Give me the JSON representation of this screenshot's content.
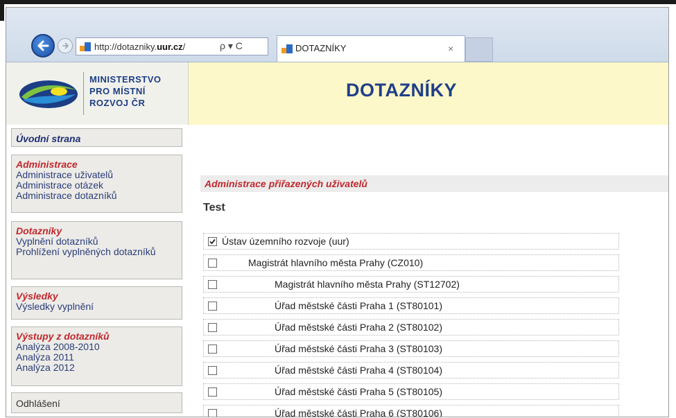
{
  "browser": {
    "address_url_prefix": "http://dotazniky.",
    "address_url_domain": "uur.cz",
    "address_url_suffix": "/",
    "address_tools": "ρ ▾ C",
    "tab_title": "DOTAZNÍKY",
    "tab_close": "×"
  },
  "header": {
    "logo_line1": "MINISTERSTVO",
    "logo_line2": "PRO MÍSTNÍ",
    "logo_line3": "ROZVOJ ČR",
    "title": "DOTAZNÍKY"
  },
  "sidebar": {
    "home": "Úvodní strana",
    "admin": {
      "head": "Administrace",
      "items": [
        "Administrace uživatelů",
        "Administrace otázek",
        "Administrace dotazníků"
      ]
    },
    "questionnaires": {
      "head": "Dotazníky",
      "items": [
        "Vyplnění dotazníků",
        "Prohlížení vyplněných dotazníků"
      ]
    },
    "results": {
      "head": "Výsledky",
      "items": [
        "Výsledky vyplnění"
      ]
    },
    "outputs": {
      "head": "Výstupy z dotazníků",
      "items": [
        "Analýza 2008-2010",
        "Analýza 2011",
        "Analýza 2012"
      ]
    },
    "logout": "Odhlášení"
  },
  "main": {
    "section_title": "Administrace přiřazených uživatelů",
    "sub_title": "Test",
    "rows": [
      {
        "label": "Ústav územního rozvoje (uur)",
        "checked": true,
        "level": 0
      },
      {
        "label": "Magistrát hlavního města Prahy (CZ010)",
        "checked": false,
        "level": 1
      },
      {
        "label": "Magistrát hlavního města Prahy (ST12702)",
        "checked": false,
        "level": 2
      },
      {
        "label": "Úřad městské části Praha 1 (ST80101)",
        "checked": false,
        "level": 2
      },
      {
        "label": "Úřad městské části Praha 2 (ST80102)",
        "checked": false,
        "level": 2
      },
      {
        "label": "Úřad městské části Praha 3 (ST80103)",
        "checked": false,
        "level": 2
      },
      {
        "label": "Úřad městské části Praha 4 (ST80104)",
        "checked": false,
        "level": 2
      },
      {
        "label": "Úřad městské části Praha 5 (ST80105)",
        "checked": false,
        "level": 2
      },
      {
        "label": "Úřad městské části Praha 6 (ST80106)",
        "checked": false,
        "level": 2
      }
    ]
  },
  "colors": {
    "accent_red": "#c0282d",
    "brand_blue": "#1f3f8a",
    "header_bg": "#fdf8c9"
  }
}
